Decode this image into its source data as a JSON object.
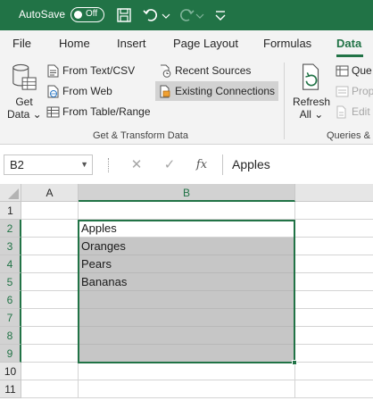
{
  "titlebar": {
    "autosave_label": "AutoSave",
    "toggle_state": "Off"
  },
  "tabs": [
    {
      "label": "File"
    },
    {
      "label": "Home"
    },
    {
      "label": "Insert"
    },
    {
      "label": "Page Layout"
    },
    {
      "label": "Formulas"
    },
    {
      "label": "Data",
      "active": true
    }
  ],
  "ribbon": {
    "get_data": {
      "line1": "Get",
      "line2": "Data ⌄"
    },
    "from_text_csv": "From Text/CSV",
    "from_web": "From Web",
    "from_table_range": "From Table/Range",
    "recent_sources": "Recent Sources",
    "existing_connections": "Existing Connections",
    "group_get_transform": "Get & Transform Data",
    "refresh": {
      "line1": "Refresh",
      "line2": "All ⌄"
    },
    "queries": "Que",
    "properties": "Prop",
    "edit_links": "Edit",
    "group_queries": "Queries &"
  },
  "formula_bar": {
    "name_box": "B2",
    "cancel_icon": "✕",
    "enter_icon": "✓",
    "fx_label": "fx",
    "content": "Apples"
  },
  "grid": {
    "columns": [
      "A",
      "B"
    ],
    "rows": [
      "1",
      "2",
      "3",
      "4",
      "5",
      "6",
      "7",
      "8",
      "9",
      "10",
      "11"
    ],
    "cells_b": [
      "",
      "Apples",
      "Oranges",
      "Pears",
      "Bananas",
      "",
      "",
      "",
      "",
      "",
      ""
    ]
  },
  "colors": {
    "brand": "#217346",
    "selection_fill": "#c6c6c6"
  }
}
